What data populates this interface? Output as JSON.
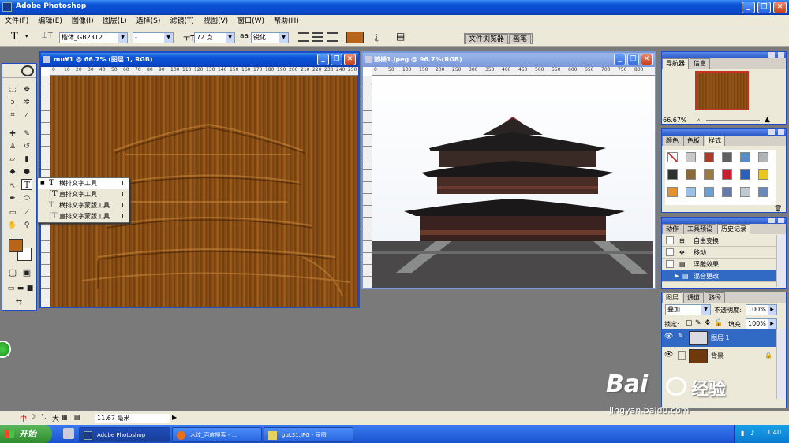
{
  "app": {
    "title": "Adobe Photoshop"
  },
  "menu": [
    "文件(F)",
    "编辑(E)",
    "图像(I)",
    "图层(L)",
    "选择(S)",
    "滤镜(T)",
    "视图(V)",
    "窗口(W)",
    "帮助(H)"
  ],
  "options": {
    "font_family": "楷体_GB2312",
    "font_style": "-",
    "font_size": "72 点",
    "aa_label": "aa",
    "antialias": "锐化",
    "color": "#b8651a"
  },
  "palette_well": [
    "文件浏览器",
    "画笔"
  ],
  "doc1": {
    "title": "mu¥1 @ 66.7% (图层 1, RGB)",
    "ruler_ticks": [
      "0",
      "10",
      "20",
      "30",
      "40",
      "50",
      "60",
      "70",
      "80",
      "90",
      "100",
      "110",
      "120",
      "130",
      "140",
      "150",
      "160",
      "170",
      "180",
      "190",
      "200",
      "210",
      "220",
      "230",
      "240",
      "250",
      "260"
    ]
  },
  "doc2": {
    "title": "鼓楼1.jpeg @ 96.7%(RGB)",
    "ruler_ticks": [
      "0",
      "50",
      "100",
      "150",
      "200",
      "250",
      "300",
      "350",
      "400",
      "450",
      "500",
      "550",
      "600",
      "650",
      "700",
      "750",
      "800"
    ]
  },
  "type_tool_menu": [
    {
      "label": "横排文字工具",
      "key": "T",
      "selected": true
    },
    {
      "label": "直排文字工具",
      "key": "T",
      "selected": false
    },
    {
      "label": "横排文字蒙版工具",
      "key": "T",
      "selected": false
    },
    {
      "label": "直排文字蒙版工具",
      "key": "T",
      "selected": false
    }
  ],
  "navigator": {
    "tabs": [
      "导航器",
      "信息"
    ],
    "zoom": "66.67%"
  },
  "styles": {
    "tabs": [
      "颜色",
      "色板",
      "样式"
    ]
  },
  "history": {
    "tabs": [
      "动作",
      "工具预设",
      "历史记录"
    ],
    "items": [
      {
        "label": "自由变换",
        "active": false
      },
      {
        "label": "移动",
        "active": false
      },
      {
        "label": "浮雕效果",
        "active": false
      },
      {
        "label": "混合更改",
        "active": true
      }
    ]
  },
  "layers": {
    "tabs": [
      "图层",
      "通道",
      "路径"
    ],
    "blend_mode": "叠加",
    "opacity_label": "不透明度:",
    "opacity": "100%",
    "lock_label": "锁定:",
    "fill_label": "填充:",
    "fill": "100%",
    "items": [
      {
        "name": "图层 1",
        "active": true
      },
      {
        "name": "背景",
        "active": false
      }
    ]
  },
  "status": {
    "ime": "中",
    "size_label": "大",
    "measure": "11.67 毫米"
  },
  "taskbar": {
    "start": "开始",
    "items": [
      "Adobe Photoshop",
      "木纹_百度搜索 - ...",
      "guL31.JPG - 画图"
    ],
    "clock": "11:40"
  },
  "watermark": {
    "brand": "Bai",
    "brand2": "经验",
    "url": "jingyan.baidu.com"
  }
}
